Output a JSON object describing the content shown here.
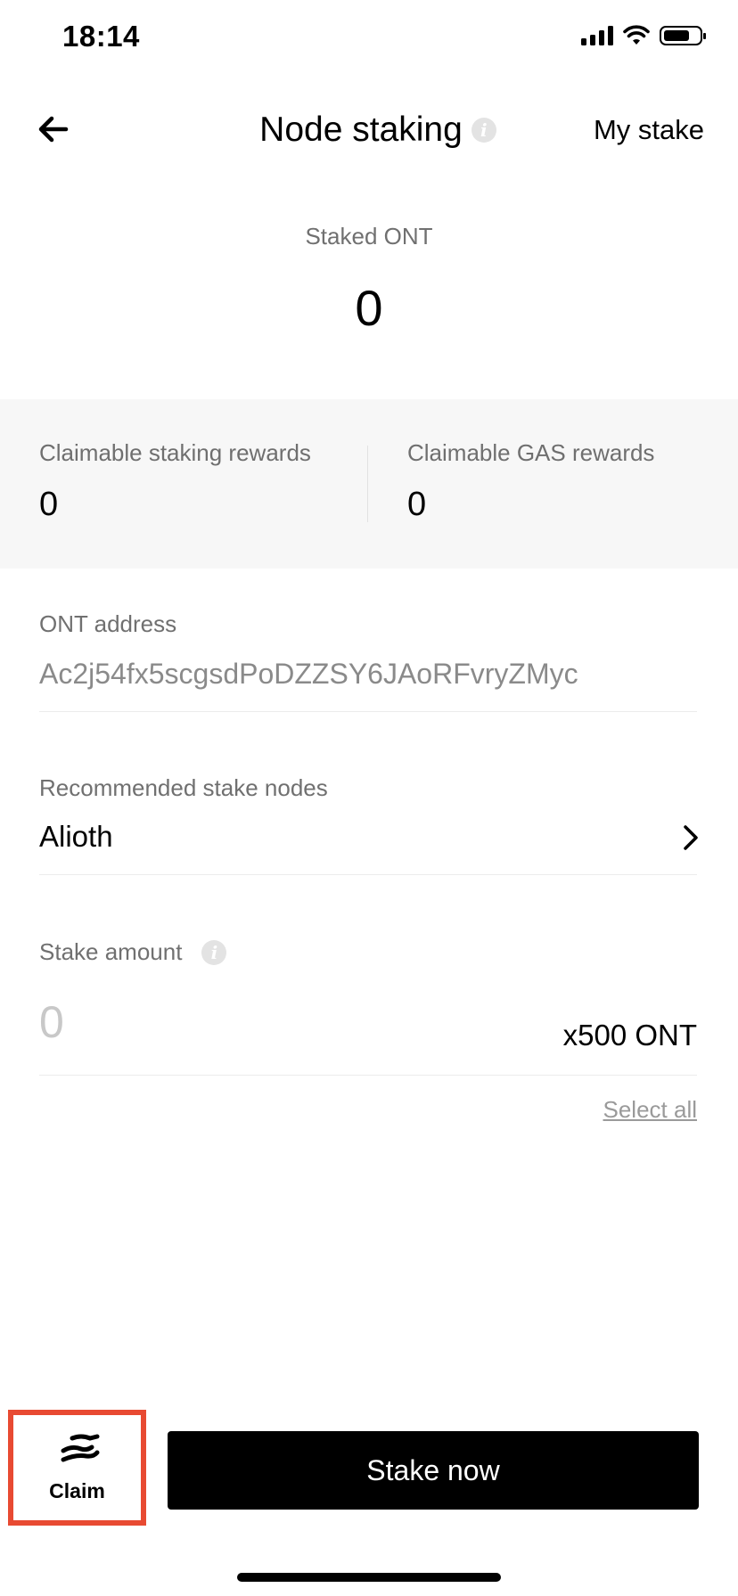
{
  "status_bar": {
    "time": "18:14",
    "icons": [
      "cellular-signal-icon",
      "wifi-icon",
      "battery-icon"
    ]
  },
  "header": {
    "back_icon": "arrow-left-icon",
    "title": "Node staking",
    "info_icon": "info-icon",
    "my_stake_label": "My stake"
  },
  "staked": {
    "label": "Staked ONT",
    "value": "0"
  },
  "rewards": {
    "staking_label": "Claimable staking rewards",
    "staking_value": "0",
    "gas_label": "Claimable GAS rewards",
    "gas_value": "0"
  },
  "address": {
    "label": "ONT address",
    "value": "Ac2j54fx5scgsdPoDZZSY6JAoRFvryZMyc"
  },
  "nodes": {
    "label": "Recommended stake nodes",
    "selected": "Alioth",
    "chevron_icon": "chevron-right-icon"
  },
  "amount": {
    "label": "Stake amount",
    "info_icon": "info-icon",
    "placeholder": "0",
    "unit": "x500 ONT",
    "select_all": "Select all"
  },
  "bottom": {
    "claim_icon": "hand-exchange-icon",
    "claim_label": "Claim",
    "stake_button": "Stake now"
  },
  "colors": {
    "highlight_border": "#e84a32",
    "primary_button": "#000000",
    "band_background": "#f7f7f7"
  }
}
